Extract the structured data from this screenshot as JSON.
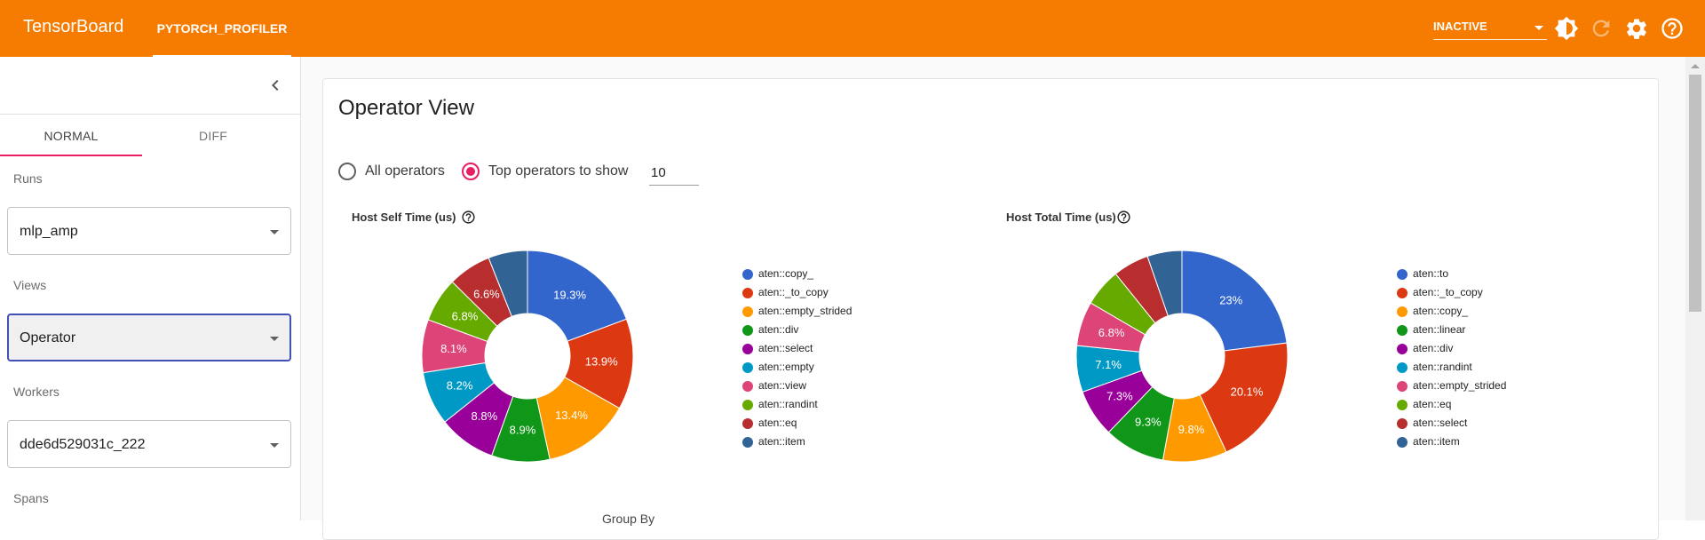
{
  "app": {
    "brand": "TensorBoard",
    "plugin_tab": "PYTORCH_PROFILER",
    "status_select": "INACTIVE",
    "icons": [
      "brightness-icon",
      "refresh-icon",
      "settings-icon",
      "help-icon"
    ]
  },
  "sidebar": {
    "tabs": [
      {
        "label": "NORMAL",
        "active": true
      },
      {
        "label": "DIFF",
        "active": false
      }
    ],
    "runs_label": "Runs",
    "runs_value": "mlp_amp",
    "views_label": "Views",
    "views_value": "Operator",
    "workers_label": "Workers",
    "workers_value": "dde6d529031c_222",
    "spans_label": "Spans"
  },
  "main": {
    "title": "Operator View",
    "radio_all": "All operators",
    "radio_top": "Top operators to show",
    "radio_selected": "top",
    "top_n": "10",
    "group_by_label": "Group By"
  },
  "colors": [
    "#3366cc",
    "#dc3912",
    "#ff9900",
    "#109618",
    "#990099",
    "#0099c6",
    "#dd4477",
    "#66aa00",
    "#b82e2e",
    "#316395"
  ],
  "chart_data": [
    {
      "type": "pie",
      "title": "Host Self Time (us)",
      "legend": [
        "aten::copy_",
        "aten::_to_copy",
        "aten::empty_strided",
        "aten::div",
        "aten::select",
        "aten::empty",
        "aten::view",
        "aten::randint",
        "aten::eq",
        "aten::item"
      ],
      "values": [
        19.3,
        13.9,
        13.4,
        8.9,
        8.8,
        8.2,
        8.1,
        6.8,
        6.6,
        6.0
      ],
      "labels": [
        "19.3%",
        "13.9%",
        "13.4%",
        "8.9%",
        "8.8%",
        "8.2%",
        "8.1%",
        "6.8%",
        "6.6%",
        ""
      ],
      "donut": true,
      "legend_position": "right"
    },
    {
      "type": "pie",
      "title": "Host Total Time (us)",
      "legend": [
        "aten::to",
        "aten::_to_copy",
        "aten::copy_",
        "aten::linear",
        "aten::div",
        "aten::randint",
        "aten::empty_strided",
        "aten::eq",
        "aten::select",
        "aten::item"
      ],
      "values": [
        23,
        20.1,
        9.8,
        9.3,
        7.3,
        7.1,
        6.8,
        5.8,
        5.5,
        5.3
      ],
      "labels": [
        "23%",
        "20.1%",
        "9.8%",
        "9.3%",
        "7.3%",
        "7.1%",
        "6.8%",
        "",
        "",
        ""
      ],
      "donut": true,
      "legend_position": "right"
    }
  ]
}
